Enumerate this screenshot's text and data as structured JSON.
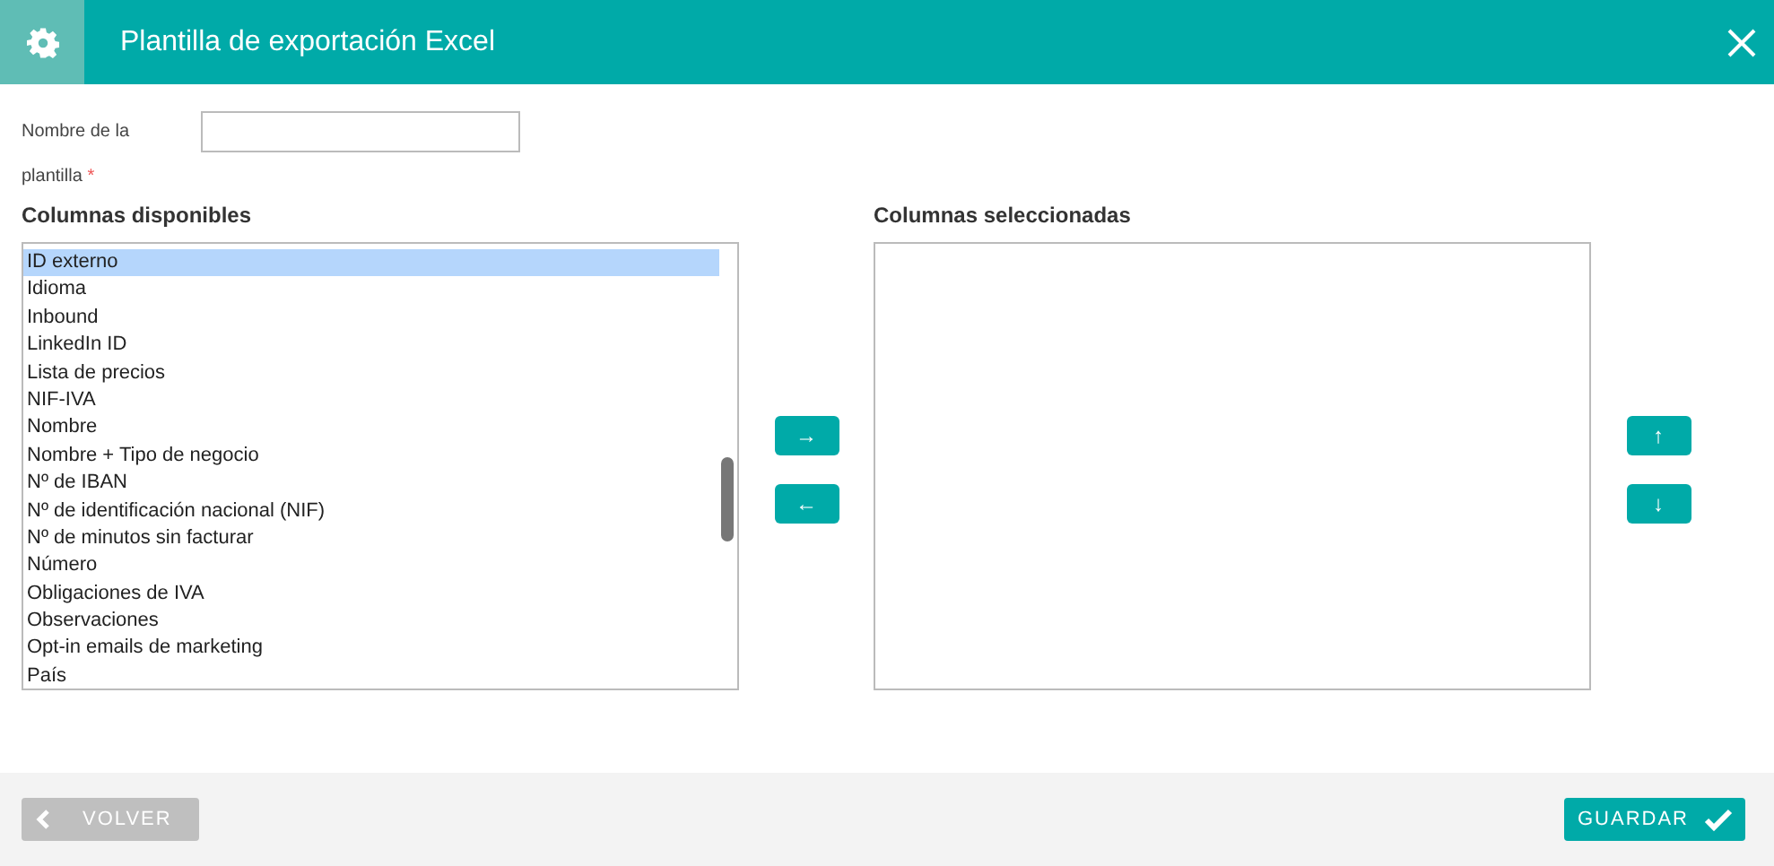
{
  "window": {
    "title": "Plantilla de exportación Excel"
  },
  "name_field": {
    "label": "Nombre de la plantilla",
    "required_mark": "*"
  },
  "available": {
    "heading": "Columnas disponibles",
    "items": [
      {
        "label": "ID externo",
        "selected": true
      },
      {
        "label": "Idioma",
        "selected": false
      },
      {
        "label": "Inbound",
        "selected": false
      },
      {
        "label": "LinkedIn ID",
        "selected": false
      },
      {
        "label": "Lista de precios",
        "selected": false
      },
      {
        "label": "NIF-IVA",
        "selected": false
      },
      {
        "label": "Nombre",
        "selected": false
      },
      {
        "label": "Nombre + Tipo de negocio",
        "selected": false
      },
      {
        "label": "Nº de IBAN",
        "selected": false
      },
      {
        "label": "Nº de identificación nacional (NIF)",
        "selected": false
      },
      {
        "label": "Nº de minutos sin facturar",
        "selected": false
      },
      {
        "label": "Número",
        "selected": false
      },
      {
        "label": "Obligaciones de IVA",
        "selected": false
      },
      {
        "label": "Observaciones",
        "selected": false
      },
      {
        "label": "Opt-in emails de marketing",
        "selected": false
      },
      {
        "label": "País",
        "selected": false
      }
    ]
  },
  "move_buttons": [
    "→",
    "←"
  ],
  "selected_columns": {
    "heading": "Columnas seleccionadas"
  },
  "order_buttons": [
    "↑",
    "↓"
  ],
  "footer": {
    "back": "VOLVER",
    "save": "GUARDAR"
  }
}
